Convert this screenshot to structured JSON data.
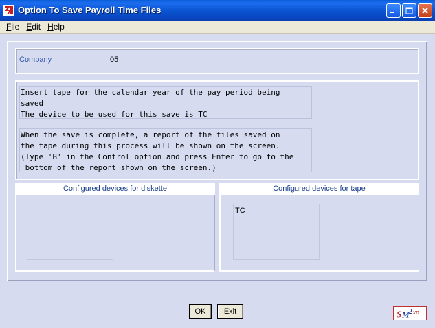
{
  "window": {
    "title": "Option To Save Payroll Time Files"
  },
  "menu": {
    "items": [
      {
        "label": "File",
        "accel": "F",
        "rest": "ile"
      },
      {
        "label": "Edit",
        "accel": "E",
        "rest": "dit"
      },
      {
        "label": "Help",
        "accel": "H",
        "rest": "elp"
      }
    ]
  },
  "company": {
    "label": "Company",
    "value": "05"
  },
  "messages": {
    "insert_text": "Insert tape for the calendar year of the pay period being\nsaved\nThe device to be used for this save is TC",
    "complete_text": "When the save is complete, a report of the files saved on\nthe tape during this process will be shown on the screen.\n(Type 'B' in the Control option and press Enter to go to the\n bottom of the report shown on the screen.)"
  },
  "devices": {
    "diskette_header": "Configured devices for diskette",
    "tape_header": "Configured devices for tape",
    "diskette_items": [],
    "tape_items": [
      "TC"
    ]
  },
  "buttons": {
    "ok": "OK",
    "exit": "Exit"
  },
  "logo": {
    "text": "SM2xp"
  },
  "colors": {
    "titlebar": "#0b55d3",
    "background": "#d6dbf0",
    "label_blue": "#2a55a8",
    "header_text": "#1c3f8c",
    "logo_red": "#c03030",
    "logo_blue": "#1a3aa0"
  }
}
